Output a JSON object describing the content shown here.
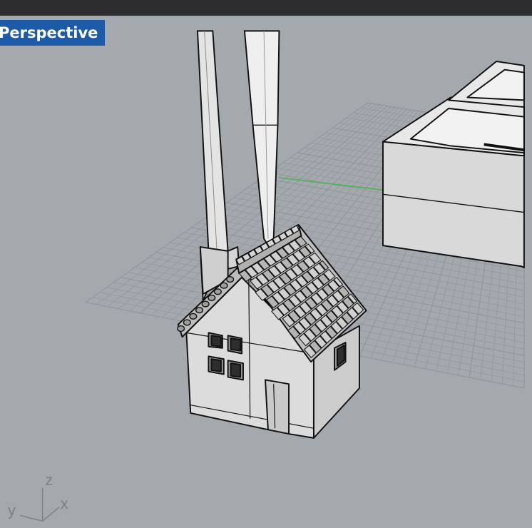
{
  "viewport": {
    "label": "Perspective",
    "axes": {
      "z": "z",
      "y": "y",
      "x": "x"
    }
  },
  "colors": {
    "background": "#a4a9ae",
    "grid": "#9296a0",
    "label_bg": "#1d5aa8",
    "x_axis_line": "#4caf50",
    "object_fill": "#d8d8d8"
  }
}
